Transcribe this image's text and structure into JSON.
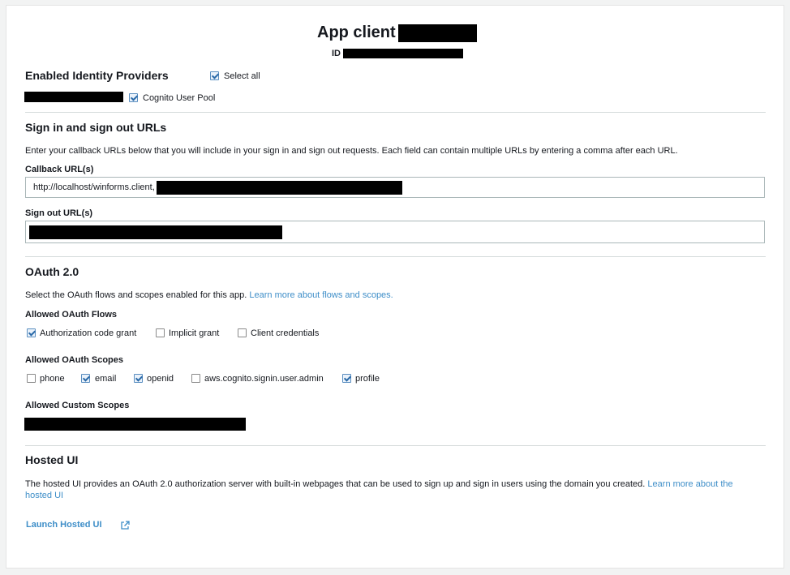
{
  "header": {
    "title": "App client",
    "id_label": "ID"
  },
  "identity_providers": {
    "heading": "Enabled Identity Providers",
    "select_all": {
      "label": "Select all",
      "checked": true
    },
    "cognito": {
      "label": "Cognito User Pool",
      "checked": true
    }
  },
  "urls": {
    "heading": "Sign in and sign out URLs",
    "description": "Enter your callback URLs below that you will include in your sign in and sign out requests. Each field can contain multiple URLs by entering a comma after each URL.",
    "callback_label": "Callback URL(s)",
    "callback_value": "http://localhost/winforms.client,",
    "signout_label": "Sign out URL(s)",
    "signout_value": ""
  },
  "oauth": {
    "heading": "OAuth 2.0",
    "description": "Select the OAuth flows and scopes enabled for this app.",
    "learn_more": "Learn more about flows and scopes.",
    "flows_label": "Allowed OAuth Flows",
    "flows": [
      {
        "label": "Authorization code grant",
        "checked": true
      },
      {
        "label": "Implicit grant",
        "checked": false
      },
      {
        "label": "Client credentials",
        "checked": false
      }
    ],
    "scopes_label": "Allowed OAuth Scopes",
    "scopes": [
      {
        "label": "phone",
        "checked": false
      },
      {
        "label": "email",
        "checked": true
      },
      {
        "label": "openid",
        "checked": true
      },
      {
        "label": "aws.cognito.signin.user.admin",
        "checked": false
      },
      {
        "label": "profile",
        "checked": true
      }
    ],
    "custom_scopes_label": "Allowed Custom Scopes"
  },
  "hosted_ui": {
    "heading": "Hosted UI",
    "description": "The hosted UI provides an OAuth 2.0 authorization server with built-in webpages that can be used to sign up and sign in users using the domain you created.",
    "learn_more_line1": "Learn more about the",
    "learn_more_line2": "hosted UI",
    "launch_label": "Launch Hosted UI",
    "launch_icon": "external-link-icon"
  }
}
